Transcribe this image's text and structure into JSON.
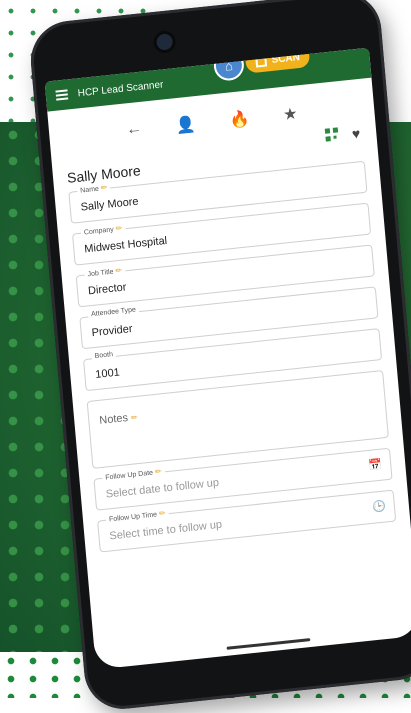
{
  "app": {
    "title": "HCP Lead Scanner",
    "scan_label": "SCAN"
  },
  "icons": {
    "menu": "hamburger-icon",
    "home": "home-icon",
    "back": "←",
    "person": "👤",
    "fire": "🔥",
    "star": "★",
    "qr": "qr-code-icon",
    "heart": "♥",
    "calendar": "📅",
    "clock": "🕒",
    "pencil": "✏"
  },
  "contact": {
    "name": "Sally Moore"
  },
  "fields": {
    "name": {
      "label": "Name",
      "value": "Sally Moore"
    },
    "company": {
      "label": "Company",
      "value": "Midwest Hospital"
    },
    "job_title": {
      "label": "Job Title",
      "value": "Director"
    },
    "attendee_type": {
      "label": "Attendee Type",
      "value": "Provider"
    },
    "booth": {
      "label": "Booth",
      "value": "1001"
    },
    "notes": {
      "placeholder": "Notes"
    },
    "follow_up_date": {
      "label": "Follow Up Date",
      "placeholder": "Select date to follow up"
    },
    "follow_up_time": {
      "label": "Follow Up Time",
      "placeholder": "Select time to follow up"
    }
  },
  "colors": {
    "brand": "#1e6a31",
    "scan": "#f2b21c",
    "home": "#4a87cf"
  }
}
